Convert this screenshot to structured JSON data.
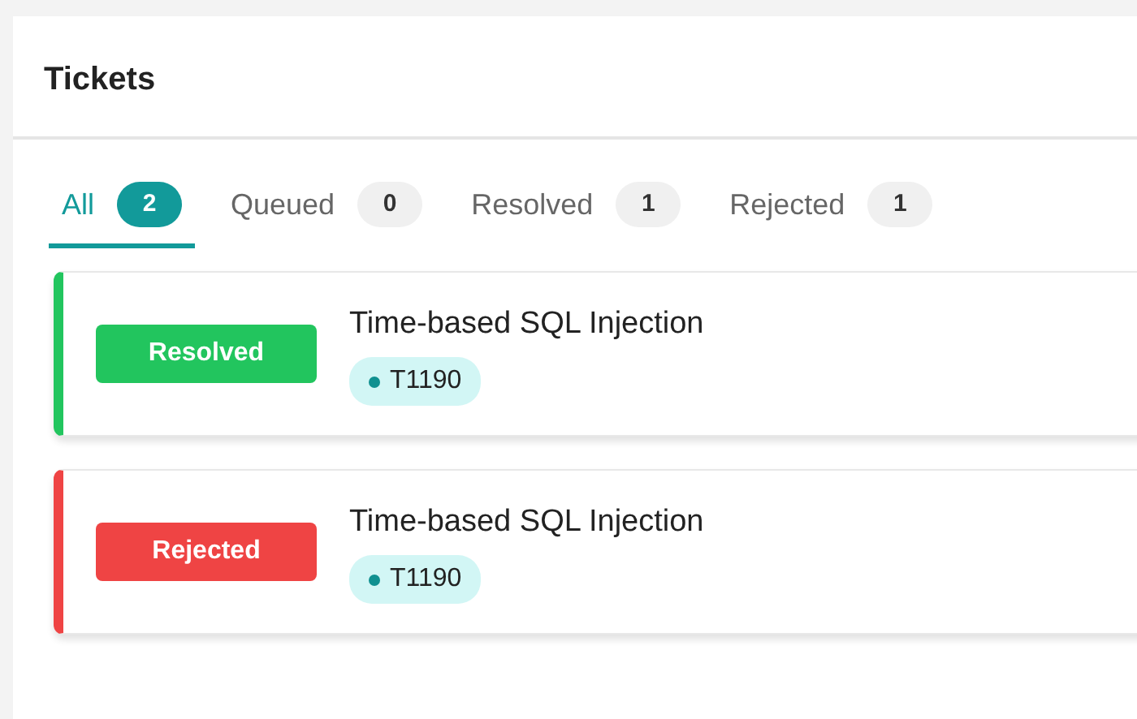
{
  "panel": {
    "title": "Tickets"
  },
  "tabs": [
    {
      "label": "All",
      "count": "2",
      "selected": true
    },
    {
      "label": "Queued",
      "count": "0",
      "selected": false
    },
    {
      "label": "Resolved",
      "count": "1",
      "selected": false
    },
    {
      "label": "Rejected",
      "count": "1",
      "selected": false
    }
  ],
  "tickets": [
    {
      "status": "Resolved",
      "color": "#22c55e",
      "title": "Time-based SQL Injection",
      "tag": "T1190"
    },
    {
      "status": "Rejected",
      "color": "#ef4444",
      "title": "Time-based SQL Injection",
      "tag": "T1190"
    }
  ]
}
